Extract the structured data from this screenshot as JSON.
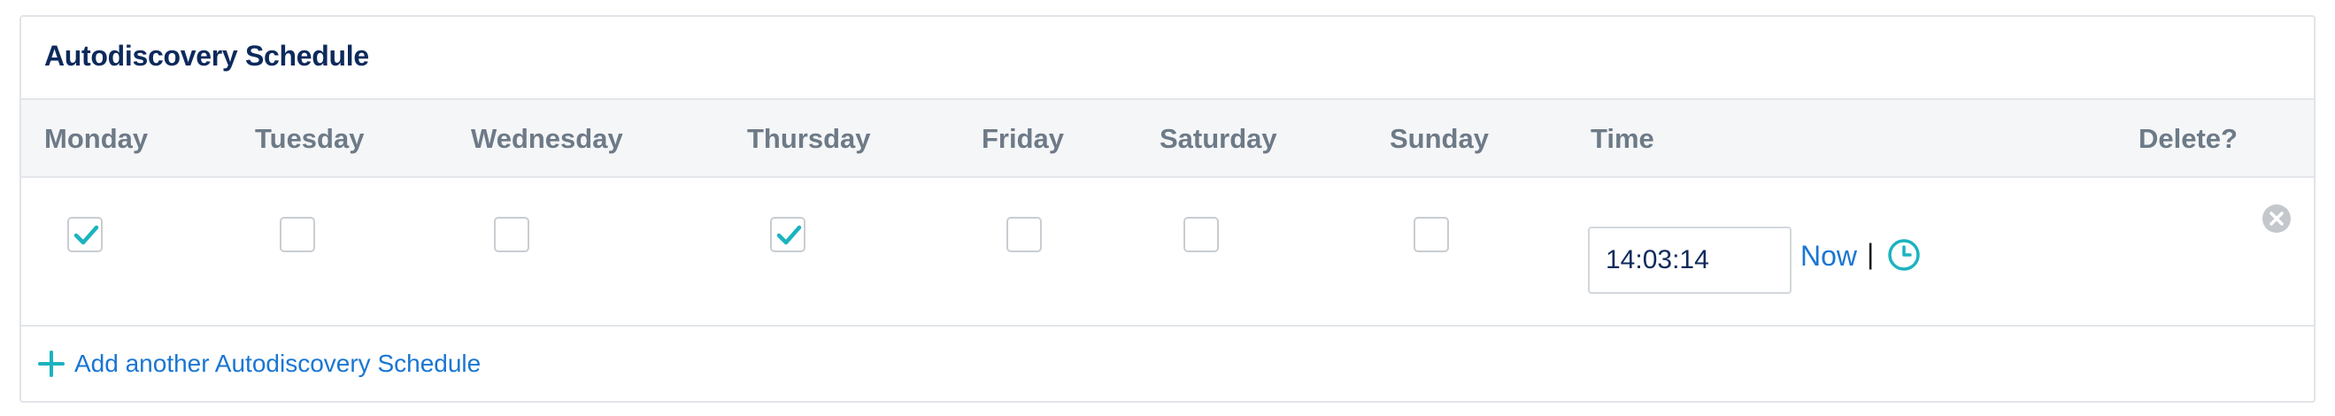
{
  "panel": {
    "title": "Autodiscovery Schedule"
  },
  "columns": {
    "monday": "Monday",
    "tuesday": "Tuesday",
    "wednesday": "Wednesday",
    "thursday": "Thursday",
    "friday": "Friday",
    "saturday": "Saturday",
    "sunday": "Sunday",
    "time": "Time",
    "delete": "Delete?"
  },
  "schedule": {
    "days_checked": {
      "monday": true,
      "tuesday": false,
      "wednesday": false,
      "thursday": true,
      "friday": false,
      "saturday": false,
      "sunday": false
    },
    "time_value": "14:03:14",
    "now_label": "Now",
    "separator": "|"
  },
  "footer": {
    "add_label": "Add another Autodiscovery Schedule"
  },
  "colors": {
    "title": "#0d2a5c",
    "header_text": "#6d7a87",
    "link": "#1a76d2",
    "check": "#1bb3bf",
    "header_bg": "#f5f6f8"
  },
  "icons": {
    "check": "checkmark-icon",
    "clock": "clock-icon",
    "delete": "remove-circle-icon",
    "add": "plus-icon"
  }
}
